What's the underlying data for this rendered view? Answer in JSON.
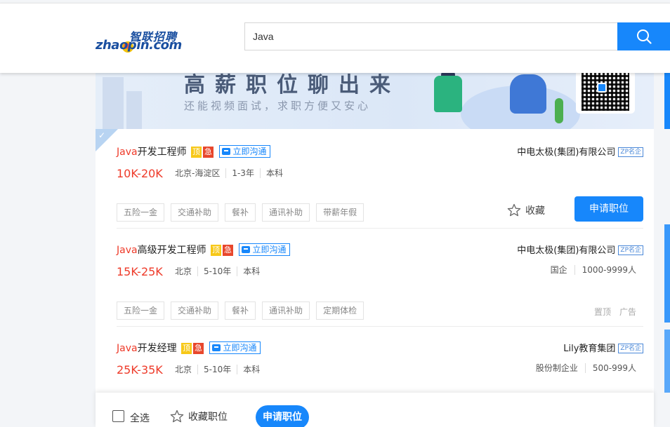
{
  "header": {
    "logo_en": "zhaopin.com",
    "logo_cn": "智联招聘",
    "search_value": "Java"
  },
  "banner": {
    "slogan": "高薪职位聊出来",
    "subtitle": "还能视频面试，求职方便又安心"
  },
  "jobs": [
    {
      "keyword": "Java",
      "title_rest": "开发工程师",
      "tag_top": "顶",
      "tag_urgent": "急",
      "chat_label": "立即沟通",
      "salary": "10K-20K",
      "location": "北京-海淀区",
      "experience": "1-3年",
      "education": "本科",
      "welfare": [
        "五险一金",
        "交通补助",
        "餐补",
        "通讯补助",
        "带薪年假"
      ],
      "company": "中电太极(集团)有限公司",
      "company_badge": "ZP名企",
      "fav_label": "收藏",
      "apply_label": "申请职位"
    },
    {
      "keyword": "Java",
      "title_rest": "高级开发工程师",
      "tag_top": "顶",
      "tag_urgent": "急",
      "chat_label": "立即沟通",
      "salary": "15K-25K",
      "location": "北京",
      "experience": "5-10年",
      "education": "本科",
      "welfare": [
        "五险一金",
        "交通补助",
        "餐补",
        "通讯补助",
        "定期体检"
      ],
      "company": "中电太极(集团)有限公司",
      "company_badge": "ZP名企",
      "company_type": "国企",
      "company_size": "1000-9999人",
      "ad_top": "置顶",
      "ad_label": "广告"
    },
    {
      "keyword": "Java",
      "title_rest": "开发经理",
      "tag_top": "顶",
      "tag_urgent": "急",
      "chat_label": "立即沟通",
      "salary": "25K-35K",
      "location": "北京",
      "experience": "5-10年",
      "education": "本科",
      "company": "Lily教育集团",
      "company_badge": "ZP名企",
      "company_type": "股份制企业",
      "company_size": "500-999人"
    }
  ],
  "bottom": {
    "select_all": "全选",
    "fav_positions": "收藏职位",
    "apply": "申请职位"
  },
  "colors": {
    "accent": "#1787fb",
    "salary_red": "#ee3a29",
    "tag_yellow": "#f7c818",
    "tag_red": "#e8472c"
  }
}
